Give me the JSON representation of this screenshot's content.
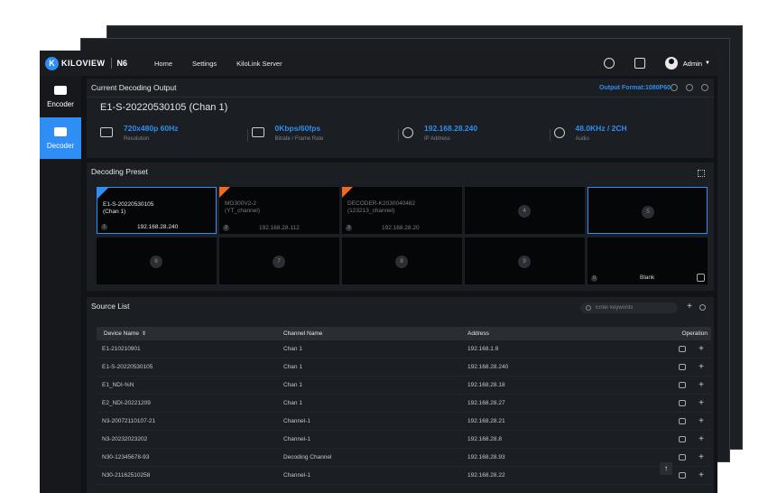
{
  "topbar": {
    "brand": "KILOVIEW",
    "model": "N6",
    "nav": [
      "Home",
      "Settings",
      "KiloLink Server"
    ],
    "user": "Admin"
  },
  "sidebar": {
    "items": [
      {
        "label": "Encoder",
        "active": false
      },
      {
        "label": "Decoder",
        "active": true
      }
    ]
  },
  "current": {
    "title": "Current Decoding Output",
    "output_format": "Output Format:1080P60",
    "channel": "E1-S-20220530105 (Chan 1)",
    "stats": [
      {
        "value": "720x480p 60Hz",
        "label": "Resolution",
        "icon": "monitor-icon"
      },
      {
        "value": "0Kbps/60fps",
        "label": "Bitrate / Frame Rate",
        "icon": "pulse-icon"
      },
      {
        "value": "192.168.28.240",
        "label": "IP Address",
        "icon": "location-icon"
      },
      {
        "value": "48.0KHz / 2CH",
        "label": "Audio",
        "icon": "headphones-icon"
      }
    ]
  },
  "presets": {
    "title": "Decoding Preset",
    "items": [
      {
        "num": "1",
        "name1": "E1-S-20220530105",
        "name2": "(Chan 1)",
        "ip": "192.168.28.240",
        "corner": "blue",
        "selected": true
      },
      {
        "num": "2",
        "name1": "MG300V2-2",
        "name2": "(YT_channel)",
        "ip": "192.168.28.112",
        "corner": "orange"
      },
      {
        "num": "3",
        "name1": "DECODER-K2030040482",
        "name2": "(123213_channel)",
        "ip": "192.168.28.20",
        "corner": "orange"
      },
      {
        "num": "4"
      },
      {
        "num": "5",
        "outlined": true
      },
      {
        "num": "6"
      },
      {
        "num": "7"
      },
      {
        "num": "8"
      },
      {
        "num": "9"
      },
      {
        "num": "0",
        "blank": "Blank"
      }
    ]
  },
  "sources": {
    "title": "Source List",
    "search_placeholder": "Enter keywords",
    "columns": [
      "Device Name",
      "Channel Name",
      "Address",
      "Operation"
    ],
    "rows": [
      [
        "E1-210210901",
        "Chan 1",
        "192.168.1.8"
      ],
      [
        "E1-S-20220530105",
        "Chan 1",
        "192.168.28.240"
      ],
      [
        "E1_NDI-%N",
        "Chan 1",
        "192.168.28.18"
      ],
      [
        "E2_NDI-20221209",
        "Chan 1",
        "192.168.28.27"
      ],
      [
        "N3-20072110107-21",
        "Channel-1",
        "192.168.28.21"
      ],
      [
        "N3-20232023202",
        "Channel-1",
        "192.168.28.8"
      ],
      [
        "N30-12345678-93",
        "Decoding Channel",
        "192.168.28.93"
      ],
      [
        "N30-21162510258",
        "Channel-1",
        "192.168.28.22"
      ]
    ]
  },
  "colors": {
    "accent": "#2f8ef5",
    "orange": "#f06a1f"
  }
}
